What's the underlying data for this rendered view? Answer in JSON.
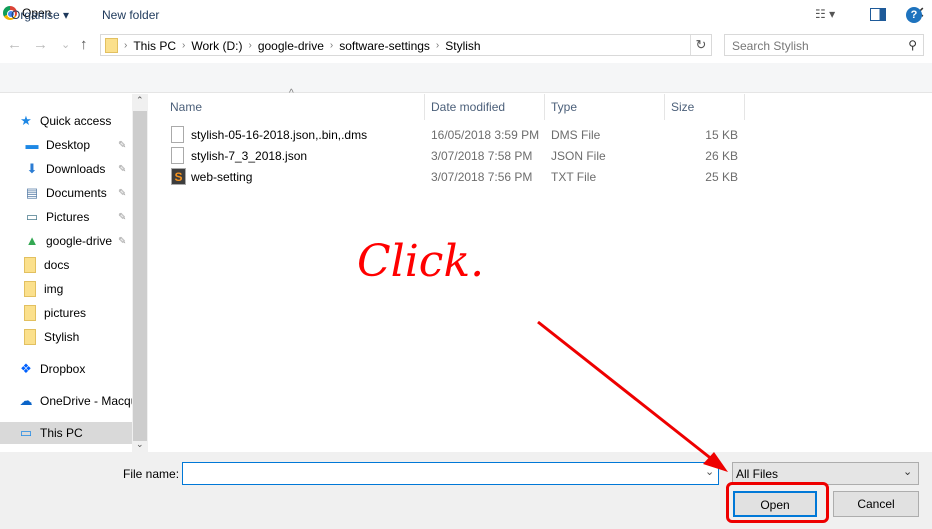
{
  "window": {
    "title": "Open",
    "close": "✕"
  },
  "nav": {
    "back": "←",
    "forward": "→",
    "recent": "⌄",
    "up": "↑"
  },
  "address": {
    "crumbs": [
      "This PC",
      "Work (D:)",
      "google-drive",
      "software-settings",
      "Stylish"
    ],
    "refresh": "↻"
  },
  "search": {
    "placeholder": "Search Stylish",
    "icon": "search-icon"
  },
  "toolbar": {
    "organise": "Organise ▾",
    "new_folder": "New folder",
    "views": "☷ ▾",
    "help": "?"
  },
  "sidebar": {
    "items": [
      {
        "label": "Quick access",
        "icon": "star-icon",
        "glyph": "★",
        "color": "#1e88e5"
      },
      {
        "label": "Desktop",
        "icon": "desktop-icon",
        "glyph": "▬",
        "color": "#1e88e5",
        "pinned": true
      },
      {
        "label": "Downloads",
        "icon": "download-icon",
        "glyph": "⬇",
        "color": "#2b7cd3",
        "pinned": true
      },
      {
        "label": "Documents",
        "icon": "document-icon",
        "glyph": "▤",
        "color": "#5a7fa8",
        "pinned": true
      },
      {
        "label": "Pictures",
        "icon": "pictures-icon",
        "glyph": "▭",
        "color": "#4a7a8c",
        "pinned": true
      },
      {
        "label": "google-drive",
        "icon": "google-drive-icon",
        "glyph": "▲",
        "color": "#34a853",
        "pinned": true
      },
      {
        "label": "docs",
        "icon": "folder-icon"
      },
      {
        "label": "img",
        "icon": "folder-icon"
      },
      {
        "label": "pictures",
        "icon": "folder-icon"
      },
      {
        "label": "Stylish",
        "icon": "folder-icon"
      },
      {
        "label": "Dropbox",
        "icon": "dropbox-icon",
        "glyph": "❖",
        "color": "#0061fe"
      },
      {
        "label": "OneDrive - Macqu",
        "icon": "onedrive-icon",
        "glyph": "☁",
        "color": "#0a64c8"
      },
      {
        "label": "This PC",
        "icon": "pc-icon",
        "glyph": "▭",
        "color": "#1e88e5",
        "selected": true
      }
    ],
    "pin": "📌"
  },
  "columns": [
    "Name",
    "Date modified",
    "Type",
    "Size"
  ],
  "files": [
    {
      "name": "stylish-05-16-2018.json,.bin,.dms",
      "date": "16/05/2018 3:59 PM",
      "type": "DMS File",
      "size": "15 KB",
      "icon": "file-icon"
    },
    {
      "name": "stylish-7_3_2018.json",
      "date": "3/07/2018 7:58 PM",
      "type": "JSON File",
      "size": "26 KB",
      "icon": "file-icon"
    },
    {
      "name": "web-setting",
      "date": "3/07/2018 7:56 PM",
      "type": "TXT File",
      "size": "25 KB",
      "icon": "sublime-text-icon"
    }
  ],
  "footer": {
    "file_name_label": "File name:",
    "file_name_value": "",
    "filter": "All Files",
    "open": "Open",
    "cancel": "Cancel"
  },
  "annotation": {
    "text": "Click.",
    "color": "#ff0000"
  }
}
